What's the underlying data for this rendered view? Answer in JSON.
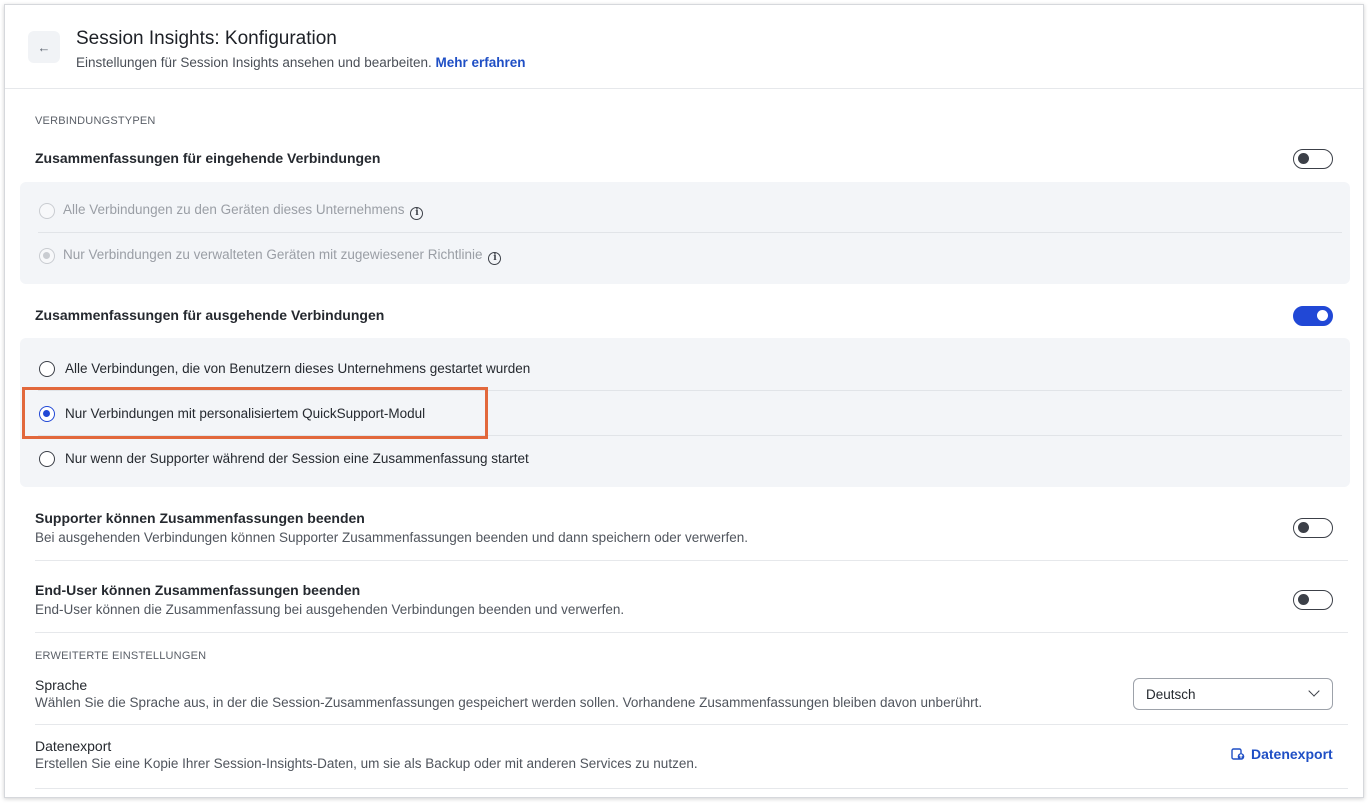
{
  "header": {
    "back_icon": "arrow-left-icon",
    "title": "Session Insights: Konfiguration",
    "subtitle": "Einstellungen für Session Insights ansehen und bearbeiten.",
    "learn_more": "Mehr erfahren"
  },
  "connection_types": {
    "section_label": "VERBINDUNGSTYPEN",
    "incoming": {
      "title": "Zusammenfassungen für eingehende Verbindungen",
      "enabled": false,
      "options": [
        {
          "label": "Alle Verbindungen zu den Geräten dieses Unternehmens",
          "selected": false,
          "disabled": true,
          "info": true
        },
        {
          "label": "Nur Verbindungen zu verwalteten Geräten mit zugewiesener Richtlinie",
          "selected": true,
          "disabled": true,
          "info": true
        }
      ]
    },
    "outgoing": {
      "title": "Zusammenfassungen für ausgehende Verbindungen",
      "enabled": true,
      "options": [
        {
          "label": "Alle Verbindungen, die von Benutzern dieses Unternehmens gestartet wurden",
          "selected": false
        },
        {
          "label": "Nur Verbindungen mit personalisiertem QuickSupport-Modul",
          "selected": true
        },
        {
          "label": "Nur wenn der Supporter während der Session eine Zusammenfassung startet",
          "selected": false
        }
      ]
    }
  },
  "supporter_end": {
    "title": "Supporter können Zusammenfassungen beenden",
    "description": "Bei ausgehenden Verbindungen können Supporter Zusammenfassungen beenden und dann speichern oder verwerfen.",
    "enabled": false
  },
  "enduser_end": {
    "title": "End-User können Zusammenfassungen beenden",
    "description": "End-User können die Zusammenfassung bei ausgehenden Verbindungen beenden und verwerfen.",
    "enabled": false
  },
  "advanced": {
    "section_label": "ERWEITERTE EINSTELLUNGEN",
    "language": {
      "title": "Sprache",
      "description": "Wählen Sie die Sprache aus, in der die Session-Zusammenfassungen gespeichert werden sollen. Vorhandene Zusammenfassungen bleiben davon unberührt.",
      "selected": "Deutsch"
    },
    "export": {
      "title": "Datenexport",
      "description": "Erstellen Sie eine Kopie Ihrer Session-Insights-Daten, um sie als Backup oder mit anderen Services zu nutzen.",
      "link_label": "Datenexport",
      "icon": "export-icon"
    }
  },
  "colors": {
    "accent": "#2148d6",
    "link": "#1f4fc5",
    "highlight": "#e2683c"
  }
}
